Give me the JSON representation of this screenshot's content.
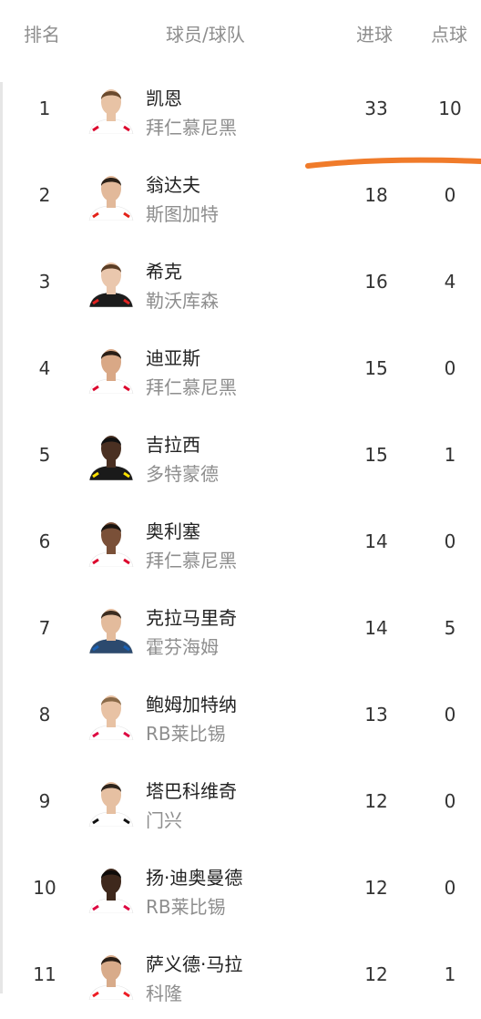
{
  "header": {
    "rank": "排名",
    "player_team": "球员/球队",
    "goals": "进球",
    "penalties": "点球"
  },
  "players": [
    {
      "rank": "1",
      "name": "凯恩",
      "team": "拜仁慕尼黑",
      "goals": "33",
      "penalties": "10",
      "skin": "#e8c3a5",
      "hair": "#6b4a2e",
      "shirt": "#ffffff",
      "accent": "#dc052d"
    },
    {
      "rank": "2",
      "name": "翁达夫",
      "team": "斯图加特",
      "goals": "18",
      "penalties": "0",
      "skin": "#e2b99a",
      "hair": "#2b2118",
      "shirt": "#ffffff",
      "accent": "#e32219"
    },
    {
      "rank": "3",
      "name": "希克",
      "team": "勒沃库森",
      "goals": "16",
      "penalties": "4",
      "skin": "#eac7ad",
      "hair": "#5a3d25",
      "shirt": "#1c1c1c",
      "accent": "#e32221"
    },
    {
      "rank": "4",
      "name": "迪亚斯",
      "team": "拜仁慕尼黑",
      "goals": "15",
      "penalties": "0",
      "skin": "#d9a886",
      "hair": "#2a1e16",
      "shirt": "#ffffff",
      "accent": "#dc052d"
    },
    {
      "rank": "5",
      "name": "吉拉西",
      "team": "多特蒙德",
      "goals": "15",
      "penalties": "1",
      "skin": "#4a3022",
      "hair": "#111111",
      "shirt": "#1a1a1a",
      "accent": "#fde100"
    },
    {
      "rank": "6",
      "name": "奥利塞",
      "team": "拜仁慕尼黑",
      "goals": "14",
      "penalties": "0",
      "skin": "#7a5038",
      "hair": "#1a1410",
      "shirt": "#ffffff",
      "accent": "#dc052d"
    },
    {
      "rank": "7",
      "name": "克拉马里奇",
      "team": "霍芬海姆",
      "goals": "14",
      "penalties": "5",
      "skin": "#e3bb9c",
      "hair": "#3b2c20",
      "shirt": "#2c4a6e",
      "accent": "#1961b5"
    },
    {
      "rank": "8",
      "name": "鲍姆加特纳",
      "team": "RB莱比锡",
      "goals": "13",
      "penalties": "0",
      "skin": "#e8c2a4",
      "hair": "#8a6a48",
      "shirt": "#ffffff",
      "accent": "#dd0741"
    },
    {
      "rank": "9",
      "name": "塔巴科维奇",
      "team": "门兴",
      "goals": "12",
      "penalties": "0",
      "skin": "#e6c0a2",
      "hair": "#2d241c",
      "shirt": "#ffffff",
      "accent": "#111111"
    },
    {
      "rank": "10",
      "name": "扬·迪奥曼德",
      "team": "RB莱比锡",
      "goals": "12",
      "penalties": "0",
      "skin": "#3e281c",
      "hair": "#0f0c0a",
      "shirt": "#ffffff",
      "accent": "#dd0741"
    },
    {
      "rank": "11",
      "name": "萨义德·马拉",
      "team": "科隆",
      "goals": "12",
      "penalties": "1",
      "skin": "#d8ab8a",
      "hair": "#2a1f17",
      "shirt": "#ffffff",
      "accent": "#ed1c24"
    }
  ],
  "colors": {
    "annotation_stroke": "#f07b2a",
    "muted_text": "#8e8e8e",
    "primary_text": "#222222"
  }
}
